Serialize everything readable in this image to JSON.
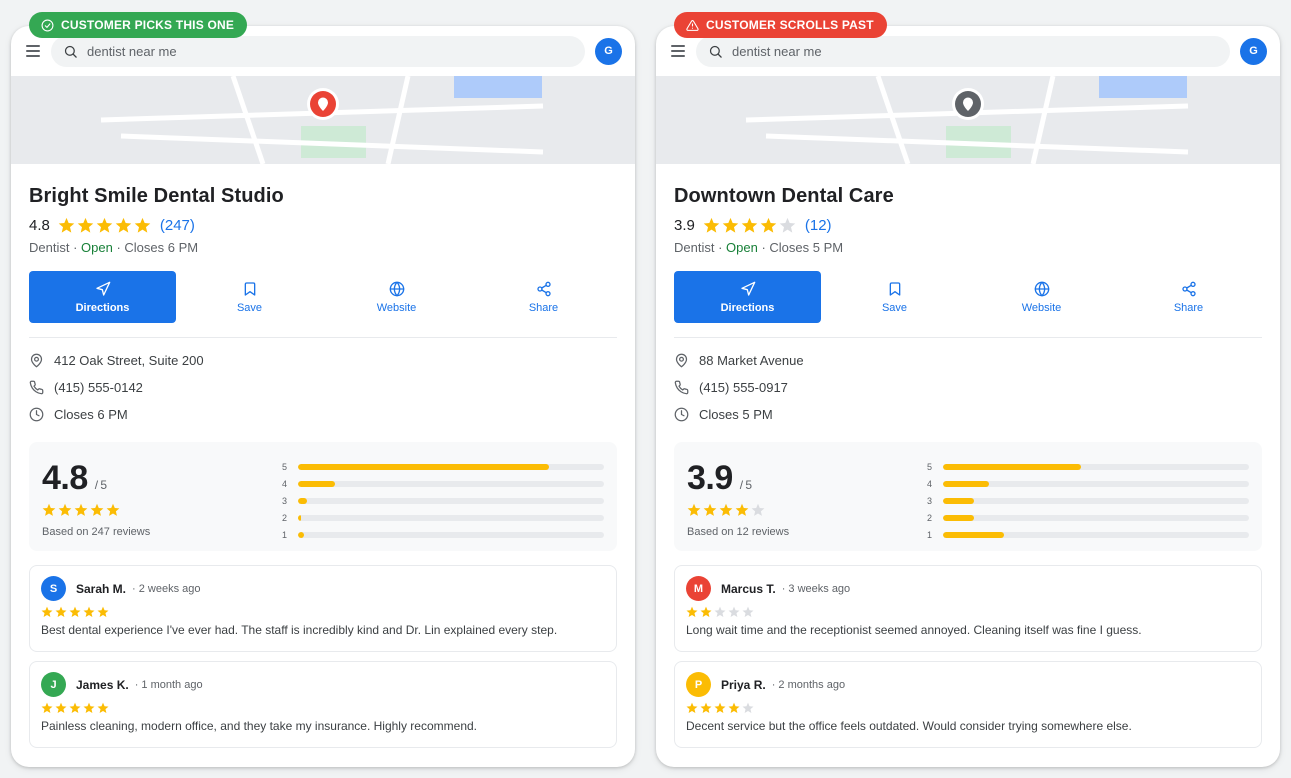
{
  "colors": {
    "accent": "#1a73e8",
    "star_filled": "#fbbc04",
    "star_empty": "#dadce0",
    "open_green": "#188038",
    "badge_good": "#34a853",
    "badge_bad": "#ea4335",
    "pin_active": "#ea4335",
    "pin_inactive": "#5f6368"
  },
  "cards": [
    {
      "badge": {
        "label": "CUSTOMER PICKS THIS ONE",
        "icon": "check-circle-icon"
      },
      "search_query": "dentist near me",
      "profile_initial": "G",
      "name": "Bright Smile Dental Studio",
      "rating": "4.8",
      "rating_value": 4.8,
      "review_count": "(247)",
      "category": "Dentist",
      "open_status": "Open",
      "closes": "Closes 6 PM",
      "actions": [
        "Directions",
        "Save",
        "Website",
        "Share"
      ],
      "address": "412 Oak Street, Suite 200",
      "phone": "(415) 555-0142",
      "hours": "Closes 6 PM",
      "summary": {
        "score": "4.8",
        "out_of": "/ 5",
        "stars": 5,
        "based_on": "Based on 247 reviews",
        "distribution": [
          {
            "label": "5",
            "fraction": 0.82
          },
          {
            "label": "4",
            "fraction": 0.12
          },
          {
            "label": "3",
            "fraction": 0.03
          },
          {
            "label": "2",
            "fraction": 0.01
          },
          {
            "label": "1",
            "fraction": 0.02
          }
        ]
      },
      "reviews": [
        {
          "initial": "S",
          "avatar_color": "#1a73e8",
          "name": "Sarah M.",
          "time": "· 2 weeks ago",
          "stars": 5,
          "text": "Best dental experience I've ever had. The staff is incredibly kind and Dr. Lin explained every step."
        },
        {
          "initial": "J",
          "avatar_color": "#34a853",
          "name": "James K.",
          "time": "· 1 month ago",
          "stars": 5,
          "text": "Painless cleaning, modern office, and they take my insurance. Highly recommend."
        }
      ]
    },
    {
      "badge": {
        "label": "CUSTOMER SCROLLS PAST",
        "icon": "warning-icon"
      },
      "search_query": "dentist near me",
      "profile_initial": "G",
      "name": "Downtown Dental Care",
      "rating": "3.9",
      "rating_value": 3.9,
      "review_count": "(12)",
      "category": "Dentist",
      "open_status": "Open",
      "closes": "Closes 5 PM",
      "actions": [
        "Directions",
        "Save",
        "Website",
        "Share"
      ],
      "address": "88 Market Avenue",
      "phone": "(415) 555-0917",
      "hours": "Closes 5 PM",
      "summary": {
        "score": "3.9",
        "out_of": "/ 5",
        "stars": 4,
        "based_on": "Based on 12 reviews",
        "distribution": [
          {
            "label": "5",
            "fraction": 0.45
          },
          {
            "label": "4",
            "fraction": 0.15
          },
          {
            "label": "3",
            "fraction": 0.1
          },
          {
            "label": "2",
            "fraction": 0.1
          },
          {
            "label": "1",
            "fraction": 0.2
          }
        ]
      },
      "reviews": [
        {
          "initial": "M",
          "avatar_color": "#ea4335",
          "name": "Marcus T.",
          "time": "· 3 weeks ago",
          "stars": 2,
          "text": "Long wait time and the receptionist seemed annoyed. Cleaning itself was fine I guess."
        },
        {
          "initial": "P",
          "avatar_color": "#fbbc04",
          "name": "Priya R.",
          "time": "· 2 months ago",
          "stars": 4,
          "text": "Decent service but the office feels outdated. Would consider trying somewhere else."
        }
      ]
    }
  ]
}
